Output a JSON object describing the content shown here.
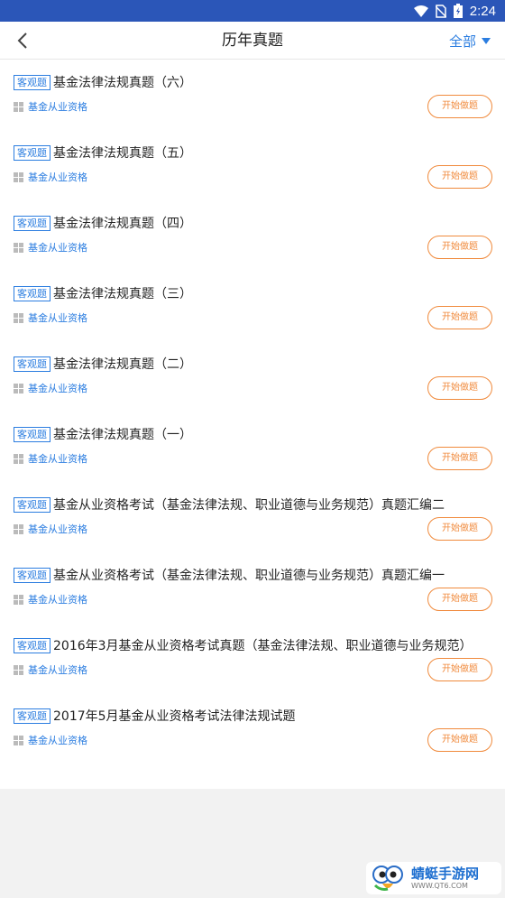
{
  "status_bar": {
    "time": "2:24",
    "icons": [
      "wifi-icon",
      "no-sim-icon",
      "battery-icon"
    ]
  },
  "header": {
    "title": "历年真题",
    "filter_label": "全部",
    "back_icon": "back-arrow-icon"
  },
  "items": [
    {
      "tag": "客观题",
      "title": "基金法律法规真题（六）",
      "category": "基金从业资格",
      "button": "开始做题"
    },
    {
      "tag": "客观题",
      "title": "基金法律法规真题（五）",
      "category": "基金从业资格",
      "button": "开始做题"
    },
    {
      "tag": "客观题",
      "title": "基金法律法规真题（四）",
      "category": "基金从业资格",
      "button": "开始做题"
    },
    {
      "tag": "客观题",
      "title": "基金法律法规真题（三）",
      "category": "基金从业资格",
      "button": "开始做题"
    },
    {
      "tag": "客观题",
      "title": "基金法律法规真题（二）",
      "category": "基金从业资格",
      "button": "开始做题"
    },
    {
      "tag": "客观题",
      "title": "基金法律法规真题（一）",
      "category": "基金从业资格",
      "button": "开始做题"
    },
    {
      "tag": "客观题",
      "title": "基金从业资格考试（基金法律法规、职业道德与业务规范）真题汇编二",
      "category": "基金从业资格",
      "button": "开始做题"
    },
    {
      "tag": "客观题",
      "title": "基金从业资格考试（基金法律法规、职业道德与业务规范）真题汇编一",
      "category": "基金从业资格",
      "button": "开始做题"
    },
    {
      "tag": "客观题",
      "title": "2016年3月基金从业资格考试真题（基金法律法规、职业道德与业务规范）",
      "category": "基金从业资格",
      "button": "开始做题"
    },
    {
      "tag": "客观题",
      "title": "2017年5月基金从业资格考试法律法规试题",
      "category": "基金从业资格",
      "button": "开始做题"
    }
  ],
  "watermark": {
    "name": "蜻蜓手游网",
    "url": "WWW.QT6.COM"
  },
  "colors": {
    "status_bar": "#2b56b8",
    "accent_blue": "#2b7de0",
    "accent_orange": "#f08a3c"
  }
}
